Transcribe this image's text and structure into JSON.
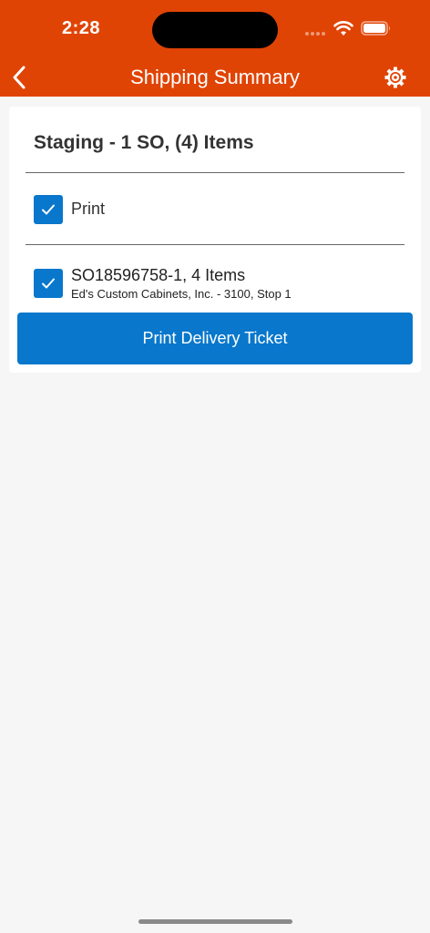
{
  "status_bar": {
    "time": "2:28",
    "icons": [
      "signal-dots-icon",
      "wifi-icon",
      "battery-icon"
    ]
  },
  "nav": {
    "title": "Shipping Summary",
    "back_icon": "chevron-left-icon",
    "settings_icon": "gear-icon"
  },
  "card": {
    "title": "Staging - 1 SO, (4) Items",
    "print_option": {
      "label": "Print",
      "checked": true
    },
    "sales_order": {
      "line": "SO18596758-1, 4 Items",
      "customer": "Ed's Custom Cabinets, Inc. - 3100, Stop 1",
      "checked": true
    },
    "button_label": "Print Delivery Ticket"
  },
  "colors": {
    "header": "#e04405",
    "accent": "#0877cc",
    "background": "#f6f6f6"
  }
}
